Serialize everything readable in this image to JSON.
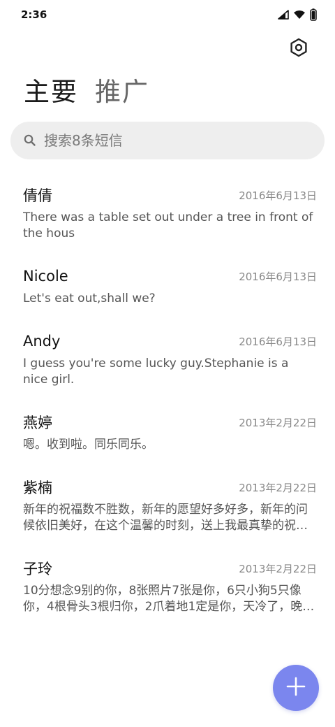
{
  "status_bar": {
    "time": "2:36",
    "icons": [
      "signal-icon",
      "wifi-icon",
      "battery-icon"
    ]
  },
  "header": {
    "settings_icon": "settings-icon"
  },
  "tabs": [
    {
      "label": "主要",
      "active": true
    },
    {
      "label": "推广",
      "active": false
    }
  ],
  "search": {
    "placeholder": "搜索8条短信",
    "value": ""
  },
  "messages": [
    {
      "sender": "倩倩",
      "date": "2016年6月13日",
      "preview": "There was a table set out under a tree in front of the hous"
    },
    {
      "sender": "Nicole",
      "date": "2016年6月13日",
      "preview": "Let's eat out,shall we?"
    },
    {
      "sender": "Andy",
      "date": "2016年6月13日",
      "preview": "I guess you're some lucky guy.Stephanie is a nice girl."
    },
    {
      "sender": "燕婷",
      "date": "2013年2月22日",
      "preview": "嗯。收到啦。同乐同乐。"
    },
    {
      "sender": "紫楠",
      "date": "2013年2月22日",
      "preview": "新年的祝福数不胜数，新年的愿望好多好多，新年的问候依旧美好，在这个温馨的时刻，送上我最真挚的祝…"
    },
    {
      "sender": "子玲",
      "date": "2013年2月22日",
      "preview": "10分想念9别的你，8张照片7张是你，6只小狗5只像你，4根骨头3根归你，2爪着地1定是你，天冷了，晚…"
    }
  ],
  "fab": {
    "icon": "plus-icon"
  },
  "colors": {
    "accent": "#7b86ee",
    "search_bg": "#eeeeee",
    "date_text": "#888888",
    "preview_text": "#555555"
  }
}
